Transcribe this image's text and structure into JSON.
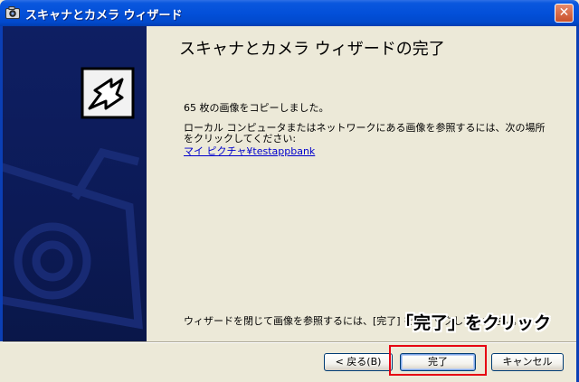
{
  "window": {
    "title": "スキャナとカメラ ウィザード",
    "close_glyph": "✕"
  },
  "page": {
    "title": "スキャナとカメラ ウィザードの完了",
    "copied_message": "65 枚の画像をコピーしました。",
    "location_message": "ローカル コンピュータまたはネットワークにある画像を参照するには、次の場所をクリックしてください:",
    "folder_link": "マイ ピクチャ¥testappbank",
    "close_instruction": "ウィザードを閉じて画像を参照するには、[完了] をクリックしてください。"
  },
  "buttons": {
    "back": "< 戻る(B)",
    "finish": "完了",
    "cancel": "キャンセル"
  },
  "annotation": {
    "callout": "「完了」をクリック",
    "color": "#e60012"
  },
  "icons": [
    "camera-icon",
    "wizard-arrow-icon",
    "close-icon"
  ]
}
